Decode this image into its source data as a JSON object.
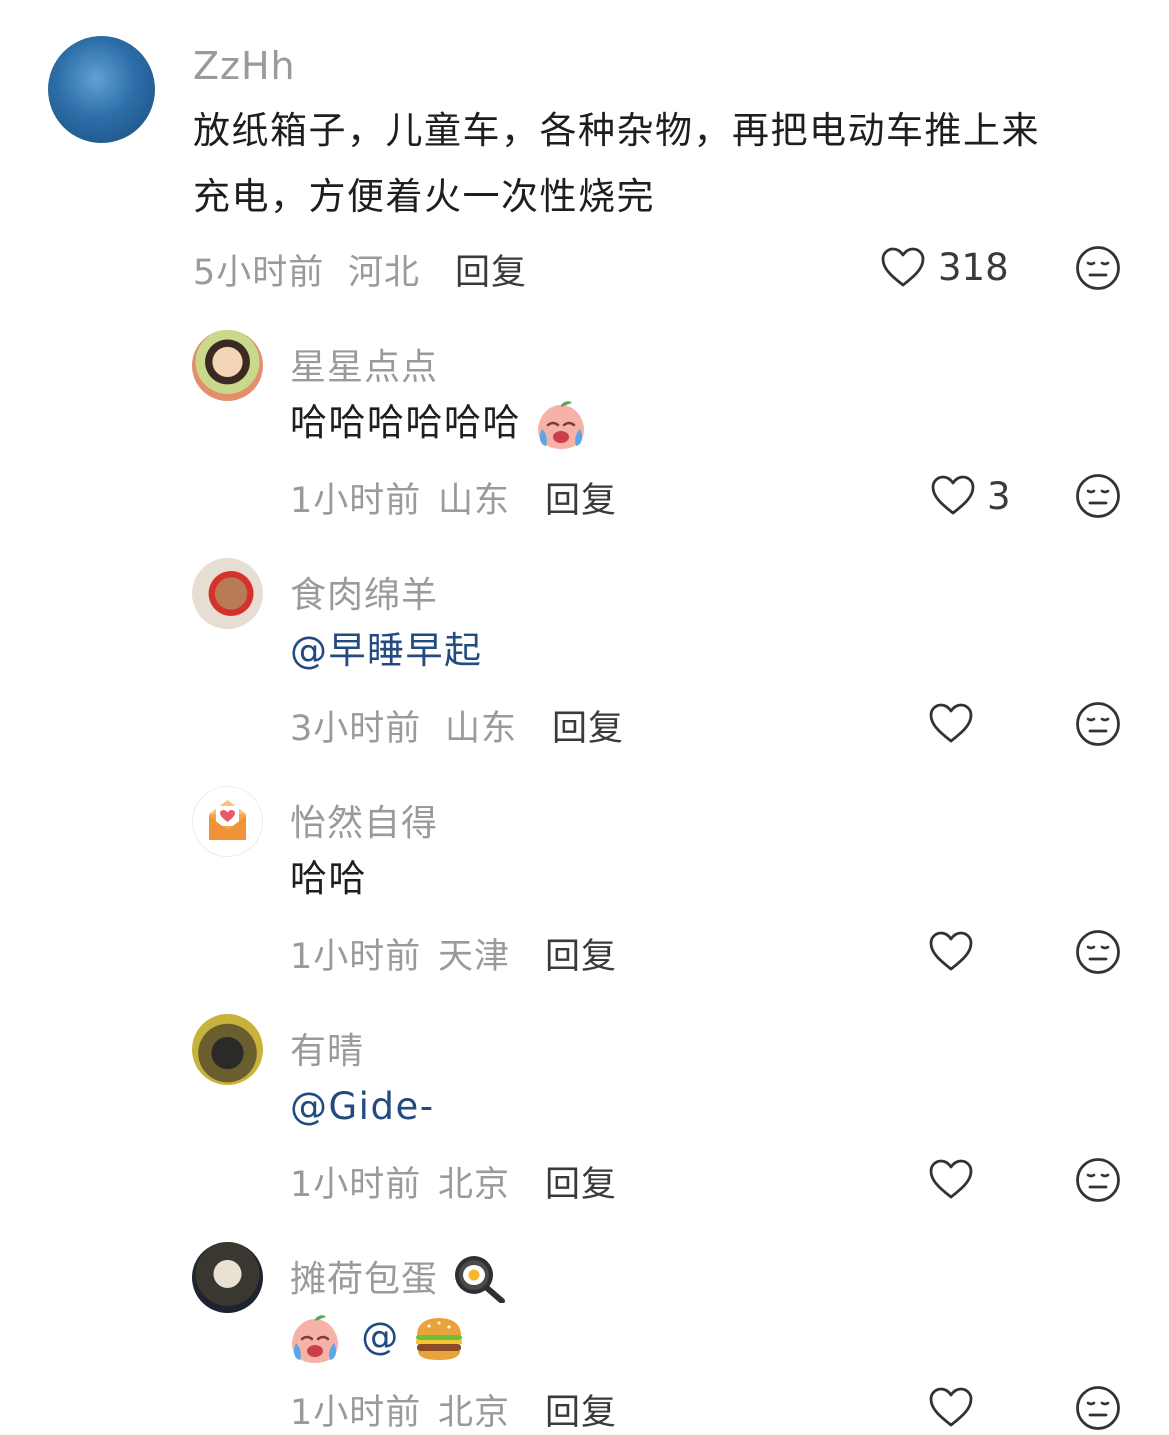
{
  "main_comment": {
    "username": "ZzHh",
    "text_line1": "放纸箱子，儿童车，各种杂物，再把电动车推上来",
    "text_line2": "充电，方便着火一次性烧完",
    "time": "5小时前",
    "location": "河北",
    "reply_label": "回复",
    "likes": "318"
  },
  "replies": [
    {
      "username": "星星点点",
      "text": "哈哈哈哈哈哈",
      "emoji": "crying-laughing-peach-icon",
      "time": "1小时前",
      "location": "山东",
      "reply_label": "回复",
      "likes": "3"
    },
    {
      "username": "食肉绵羊",
      "mention": "@早睡早起",
      "time": "3小时前",
      "location": "山东",
      "reply_label": "回复",
      "likes": ""
    },
    {
      "username": "怡然自得",
      "text": "哈哈",
      "time": "1小时前",
      "location": "天津",
      "reply_label": "回复",
      "likes": ""
    },
    {
      "username": "有晴",
      "mention": "@Gide-",
      "time": "1小时前",
      "location": "北京",
      "reply_label": "回复",
      "likes": ""
    },
    {
      "username": "摊荷包蛋",
      "username_emoji": "frying-pan-egg-icon",
      "mention": "@",
      "emoji_before": "crying-laughing-peach-icon",
      "emoji_after": "hamburger-icon",
      "time": "1小时前",
      "location": "北京",
      "reply_label": "回复",
      "likes": ""
    }
  ],
  "colors": {
    "username": "#9a9a9a",
    "mention": "#244b80",
    "text": "#1e1e1e",
    "meta": "#9a9a9a"
  }
}
